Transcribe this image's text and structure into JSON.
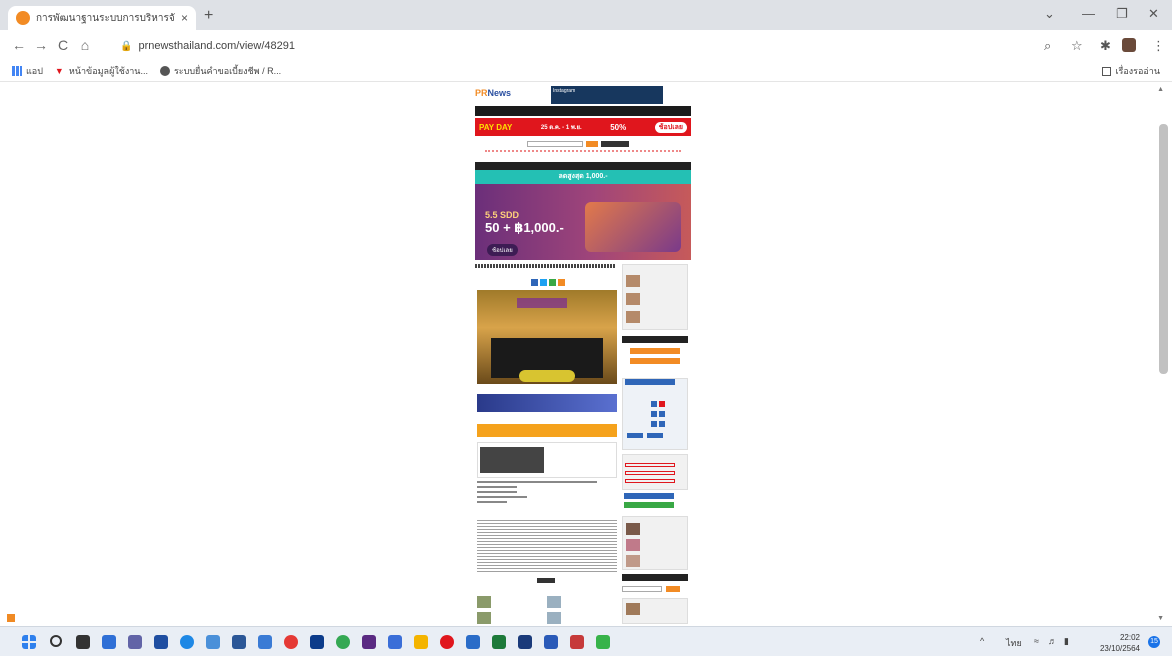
{
  "browser": {
    "tab_title": "การพัฒนาฐานระบบการบริหารจัดการกี...",
    "tab_close": "×",
    "new_tab": "+",
    "url": "prnewsthailand.com/view/48291",
    "nav": {
      "back": "←",
      "forward": "→",
      "reload": "C",
      "home": "⌂"
    },
    "window": {
      "minimize": "—",
      "restore": "❐",
      "close": "✕",
      "dropdown": "⌄"
    },
    "toolbar_icons": {
      "zoom": "⌕",
      "star": "☆",
      "extensions": "✱",
      "menu": "⋮"
    }
  },
  "bookmarks": {
    "items": [
      {
        "label": "แอป"
      },
      {
        "label": "หน้าข้อมูลผู้ใช้งาน..."
      },
      {
        "label": "ระบบยื่นคำขอเบี้ยงชีพ / R..."
      }
    ],
    "reading_list": "เรื่องรออ่าน"
  },
  "site": {
    "logo_pr": "PR",
    "logo_news": "News",
    "top_ad": "Instagram",
    "promo_left": "PAY DAY",
    "promo_sub": "25 ต.ค. - 1 พ.ย.",
    "promo_mid": "50%",
    "promo_btn": "ช้อปเลย",
    "green_banner": "ลดสูงสุด 1,000.-",
    "bigad_line1": "5.5 SDD",
    "bigad_line2": "50 + ฿1,000.-",
    "bigad_cta": "ช้อปเลย"
  },
  "colors": {
    "accent": "#f28b24",
    "brand_blue": "#2a4fa0",
    "promo_red": "#e0161d",
    "teal": "#24c0b4"
  },
  "taskbar": {
    "tray_lang": "ไทย",
    "tray_up": "^",
    "time": "22:02",
    "date": "23/10/2564",
    "notif_count": "15"
  }
}
